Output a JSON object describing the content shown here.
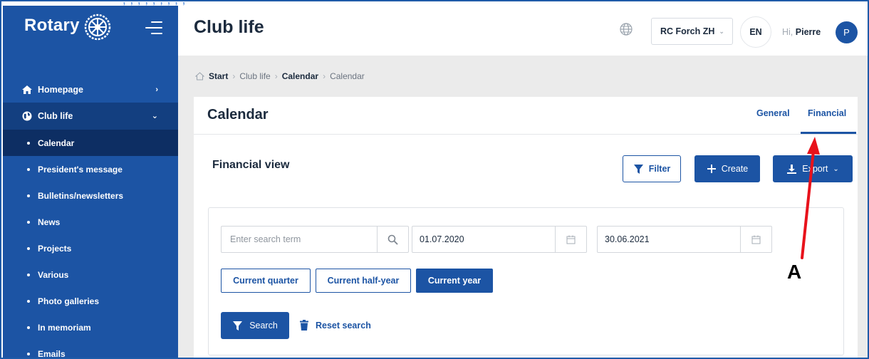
{
  "sidebar": {
    "brand": "Rotary",
    "items": [
      {
        "label": "Homepage",
        "icon": "home-icon"
      },
      {
        "label": "Club life",
        "icon": "globe-icon"
      }
    ],
    "sub_items": [
      "Calendar",
      "President's message",
      "Bulletins/newsletters",
      "News",
      "Projects",
      "Various",
      "Photo galleries",
      "In memoriam",
      "Emails"
    ],
    "active_sub": "Calendar"
  },
  "header": {
    "title": "Club life",
    "club_select": "RC Forch ZH",
    "language": "EN",
    "greeting_prefix": "Hi,",
    "user_name": "Pierre",
    "avatar_initial": "P"
  },
  "breadcrumb": [
    "Start",
    "Club life",
    "Calendar",
    "Calendar"
  ],
  "card": {
    "title": "Calendar",
    "tabs": [
      "General",
      "Financial"
    ],
    "active_tab": "Financial",
    "section_title": "Financial view",
    "buttons": {
      "filter": "Filter",
      "create": "Create",
      "export": "Export"
    }
  },
  "filter_panel": {
    "search_placeholder": "Enter search term",
    "date_from": "01.07.2020",
    "date_to": "30.06.2021",
    "periods": [
      "Current quarter",
      "Current half-year",
      "Current year"
    ],
    "active_period": "Current year",
    "search_label": "Search",
    "reset_label": "Reset search"
  },
  "annotation": {
    "label": "A",
    "color": "#e8121b"
  },
  "colors": {
    "primary": "#1c54a4",
    "sidebar_active": "#0d2e63",
    "sidebar_expanded": "#133f80",
    "background": "#ebebeb"
  }
}
